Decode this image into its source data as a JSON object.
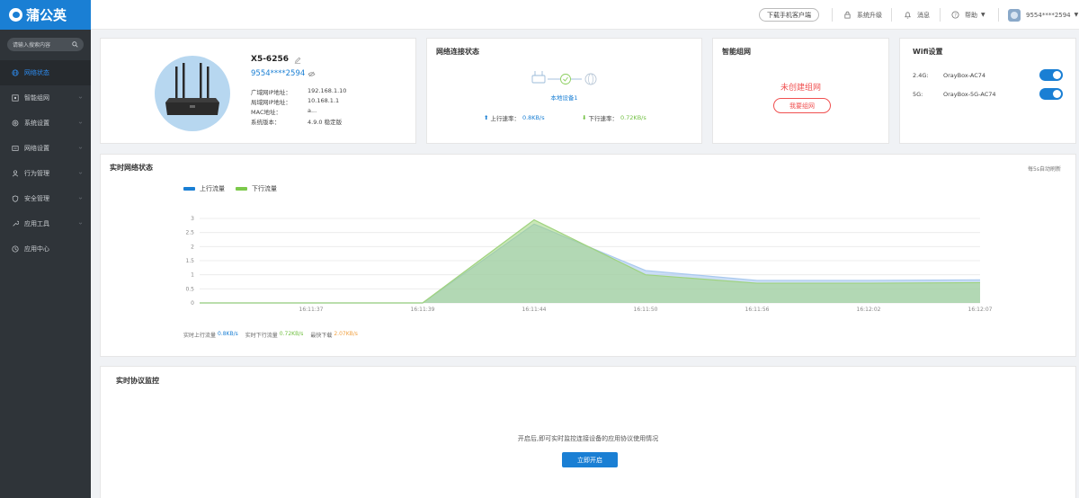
{
  "app": {
    "logo_text": "蒲公英"
  },
  "sidebar": {
    "search_placeholder": "请输入搜索内容",
    "items": [
      {
        "label": "网络状态",
        "icon": "globe-icon",
        "active": true
      },
      {
        "label": "智能组网",
        "icon": "network-icon",
        "expandable": true
      },
      {
        "label": "系统设置",
        "icon": "gear-icon",
        "expandable": true
      },
      {
        "label": "网络设置",
        "icon": "network-settings-icon",
        "expandable": true
      },
      {
        "label": "行为管理",
        "icon": "behavior-icon",
        "expandable": true
      },
      {
        "label": "安全管理",
        "icon": "shield-icon",
        "expandable": true
      },
      {
        "label": "应用工具",
        "icon": "tools-icon",
        "expandable": true
      },
      {
        "label": "应用中心",
        "icon": "app-center-icon"
      }
    ]
  },
  "topbar": {
    "download_label": "下载手机客户端",
    "upgrade_label": "系统升级",
    "message_label": "消息",
    "help_label": "帮助",
    "user_label": "9554****2594"
  },
  "device": {
    "name": "X5-6256",
    "id": "9554****2594",
    "rows": [
      {
        "key": "广域网IP地址：",
        "value": "192.168.1.10"
      },
      {
        "key": "局域网IP地址：",
        "value": "10.168.1.1"
      },
      {
        "key": "MAC地址：",
        "value": "a..."
      },
      {
        "key": "系统版本：",
        "value": "4.9.0 稳定版"
      }
    ]
  },
  "net_status": {
    "title": "网络连接状态",
    "device_label": "本地设备1",
    "up_label": "上行速率：",
    "up_value": "0.8KB/s",
    "down_label": "下行速率：",
    "down_value": "0.72KB/s"
  },
  "smart_group": {
    "title": "智能组网",
    "status": "未创建组网",
    "button": "我要组网"
  },
  "wifi": {
    "title": "Wifi设置",
    "bands": [
      {
        "band": "2.4G:",
        "ssid": "OrayBox-AC74",
        "enabled": true
      },
      {
        "band": "5G:",
        "ssid": "OrayBox-5G-AC74",
        "enabled": true
      }
    ]
  },
  "realtime": {
    "title": "实时网络状态",
    "refresh_note": "每5s自动刷新",
    "legend_up": "上行流量",
    "legend_down": "下行流量",
    "footer": {
      "up_label": "实时上行流量",
      "up_value": "0.8KB/s",
      "down_label": "实时下行流量",
      "down_value": "0.72KB/s",
      "max_label": "最快下载",
      "max_value": "2.07KB/s"
    }
  },
  "chart_data": {
    "type": "area",
    "x": [
      "",
      "16:11:37",
      "16:11:39",
      "16:11:44",
      "16:11:50",
      "16:11:56",
      "16:12:02",
      "16:12:07"
    ],
    "yticks": [
      0,
      0.5,
      1,
      1.5,
      2,
      2.5,
      3
    ],
    "ylim": [
      0,
      3
    ],
    "series": [
      {
        "name": "上行流量",
        "color": "#a8c8ee",
        "values": [
          0,
          0,
          0,
          2.8,
          1.15,
          0.8,
          0.8,
          0.82
        ]
      },
      {
        "name": "下行流量",
        "color": "#9fd37e",
        "values": [
          0,
          0,
          0,
          2.95,
          1.0,
          0.7,
          0.7,
          0.72
        ]
      }
    ],
    "grid": true,
    "legend_position": "top-left"
  },
  "protocol": {
    "title": "实时协议监控",
    "desc": "开启后,即可实时监控连接设备的应用协议使用情况",
    "button": "立即开启"
  }
}
